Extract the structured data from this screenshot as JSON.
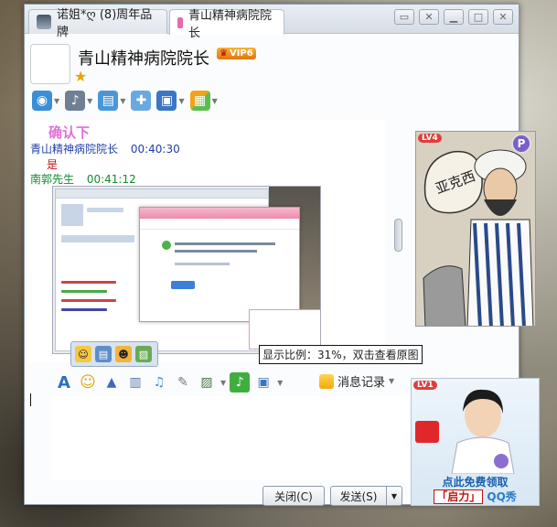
{
  "tabs": [
    {
      "label": "诺姐*ღ (8)周年品牌",
      "active": false
    },
    {
      "label": "青山精神病院院长",
      "active": true
    }
  ],
  "header": {
    "contact_name": "青山精神病院院长",
    "vip_label": "VIP6"
  },
  "window_controls": [
    "restore",
    "close-small",
    "minimize",
    "maximize",
    "close"
  ],
  "toolbar_top": [
    {
      "icon": "video-icon",
      "color": "#3a8fd6"
    },
    {
      "icon": "microphone-icon",
      "color": "#6f7f94"
    },
    {
      "icon": "folder-transfer-icon",
      "color": "#4a97d8"
    },
    {
      "icon": "chat-add-icon",
      "color": "#6aa9e0"
    },
    {
      "icon": "screen-share-icon",
      "color": "#3b76c4"
    },
    {
      "icon": "apps-icon",
      "color": "#f2a31b"
    }
  ],
  "chat": {
    "messages": [
      {
        "kind": "pink",
        "text": "确认下"
      },
      {
        "kind": "blue",
        "sender": "青山精神病院院长",
        "time": "00:40:30"
      },
      {
        "kind": "red",
        "text": "是"
      },
      {
        "kind": "green",
        "sender": "南郭先生",
        "time": "00:41:12"
      }
    ],
    "tooltip": "显示比例：31%，双击查看原图"
  },
  "right_panel": {
    "level": "LV4",
    "p_button": "P"
  },
  "toolbar_bottom": [
    {
      "icon": "font-icon"
    },
    {
      "icon": "emoji-icon"
    },
    {
      "icon": "magic-icon"
    },
    {
      "icon": "video-msg-icon"
    },
    {
      "icon": "voice-msg-icon"
    },
    {
      "icon": "handwrite-icon"
    },
    {
      "icon": "image-icon"
    },
    {
      "icon": "music-icon"
    },
    {
      "icon": "screenshot-icon"
    }
  ],
  "message_history_label": "消息记录",
  "ad": {
    "level": "LV1",
    "line1": "点此免费领取",
    "brand_qi": "「启力」",
    "brand_rest": "QQ秀"
  },
  "buttons": {
    "close": "关闭(C)",
    "send": "发送(S)"
  }
}
